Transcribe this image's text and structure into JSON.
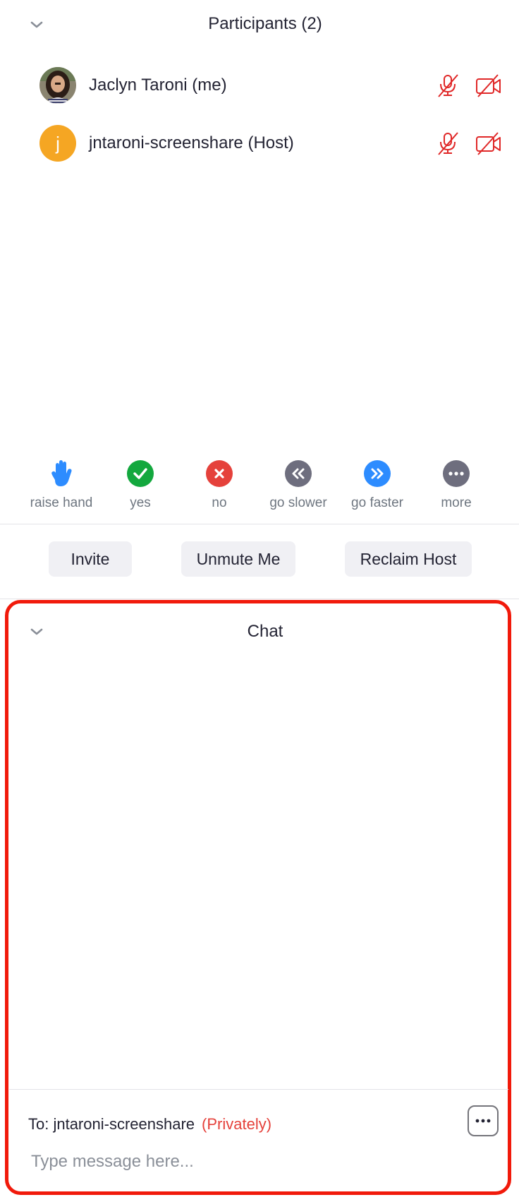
{
  "participants": {
    "title": "Participants (2)",
    "list": [
      {
        "name": "Jaclyn Taroni (me)",
        "avatar_type": "photo",
        "mic": "muted",
        "video": "off"
      },
      {
        "name": "jntaroni-screenshare (Host)",
        "avatar_letter": "j",
        "avatar_color": "#F5A623",
        "mic": "muted",
        "video": "off"
      }
    ]
  },
  "reactions": [
    {
      "label": "raise hand",
      "icon": "raise-hand-icon",
      "color": "#2D8CFF"
    },
    {
      "label": "yes",
      "icon": "check-icon",
      "color": "#13A83E"
    },
    {
      "label": "no",
      "icon": "x-icon",
      "color": "#E5413B"
    },
    {
      "label": "go slower",
      "icon": "rewind-icon",
      "color": "#6E6E7E"
    },
    {
      "label": "go faster",
      "icon": "fast-forward-icon",
      "color": "#2D8CFF"
    },
    {
      "label": "more",
      "icon": "more-dots-icon",
      "color": "#6E6E7E"
    }
  ],
  "actions": {
    "invite": "Invite",
    "unmute": "Unmute Me",
    "reclaim": "Reclaim Host"
  },
  "chat": {
    "title": "Chat",
    "to_label": "To: jntaroni-screenshare",
    "privately": "(Privately)",
    "placeholder": "Type message here...",
    "highlight_color": "#F11A0B"
  },
  "colors": {
    "muted_icon": "#E02828",
    "text": "#232333",
    "secondary_text": "#6E7680"
  }
}
